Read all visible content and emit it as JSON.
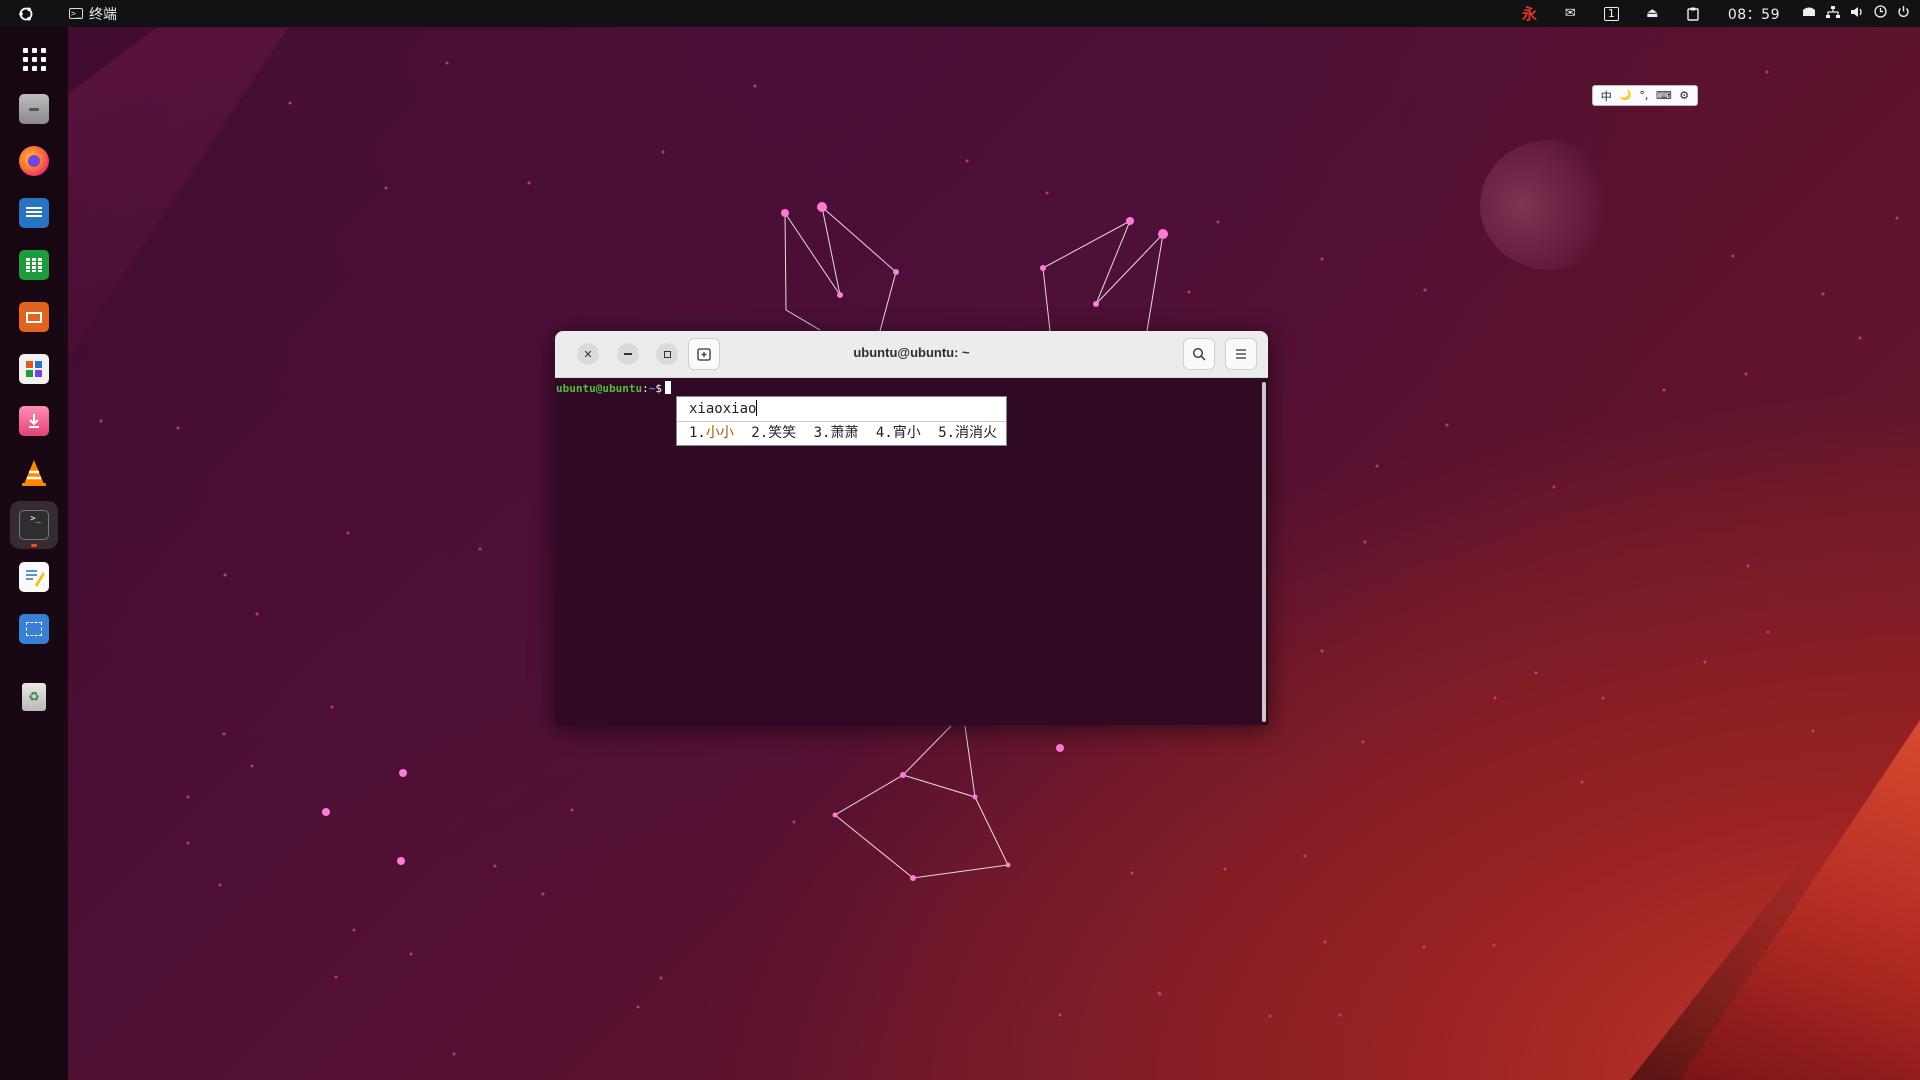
{
  "topbar": {
    "app_name": "终端",
    "clock": "08：59",
    "indicators": [
      "永",
      "✉",
      "1",
      "⏏",
      "📋"
    ],
    "system_icons": [
      "network-icon",
      "volume-icon",
      "power-icon"
    ]
  },
  "dock": {
    "items": [
      {
        "name": "app-grid",
        "label": "Show Apps"
      },
      {
        "name": "files",
        "label": "Files"
      },
      {
        "name": "firefox",
        "label": "Firefox"
      },
      {
        "name": "writer",
        "label": "LibreOffice Writer"
      },
      {
        "name": "calc",
        "label": "LibreOffice Calc"
      },
      {
        "name": "impress",
        "label": "LibreOffice Impress"
      },
      {
        "name": "app-center",
        "label": "App Center"
      },
      {
        "name": "installer",
        "label": "Install Ubuntu"
      },
      {
        "name": "vlc",
        "label": "VLC"
      },
      {
        "name": "terminal",
        "label": "Terminal"
      },
      {
        "name": "text-editor",
        "label": "Text Editor"
      },
      {
        "name": "screenshot",
        "label": "Screenshot"
      },
      {
        "name": "trash",
        "label": "Trash"
      }
    ]
  },
  "ime_toolbar": {
    "mode": "中",
    "punct": "🌙",
    "symbol": "°,",
    "keyboard": "⌨",
    "settings": "⚙"
  },
  "terminal": {
    "title": "ubuntu@ubuntu: ~",
    "prompt_user": "ubuntu@ubuntu",
    "prompt_sep": ":",
    "prompt_path": "~",
    "prompt_symbol": "$"
  },
  "ime_popup": {
    "preedit": "xiaoxiao",
    "candidates": [
      {
        "index": "1.",
        "word": "小小"
      },
      {
        "index": "2.",
        "word": "笑笑"
      },
      {
        "index": "3.",
        "word": "萧萧"
      },
      {
        "index": "4.",
        "word": "宵小"
      },
      {
        "index": "5.",
        "word": "消消火"
      }
    ]
  },
  "colors": {
    "terminal_bg": "#300a24",
    "prompt_user": "#4ebe3a",
    "prompt_path": "#5a8fd8",
    "accent": "#e95420"
  }
}
